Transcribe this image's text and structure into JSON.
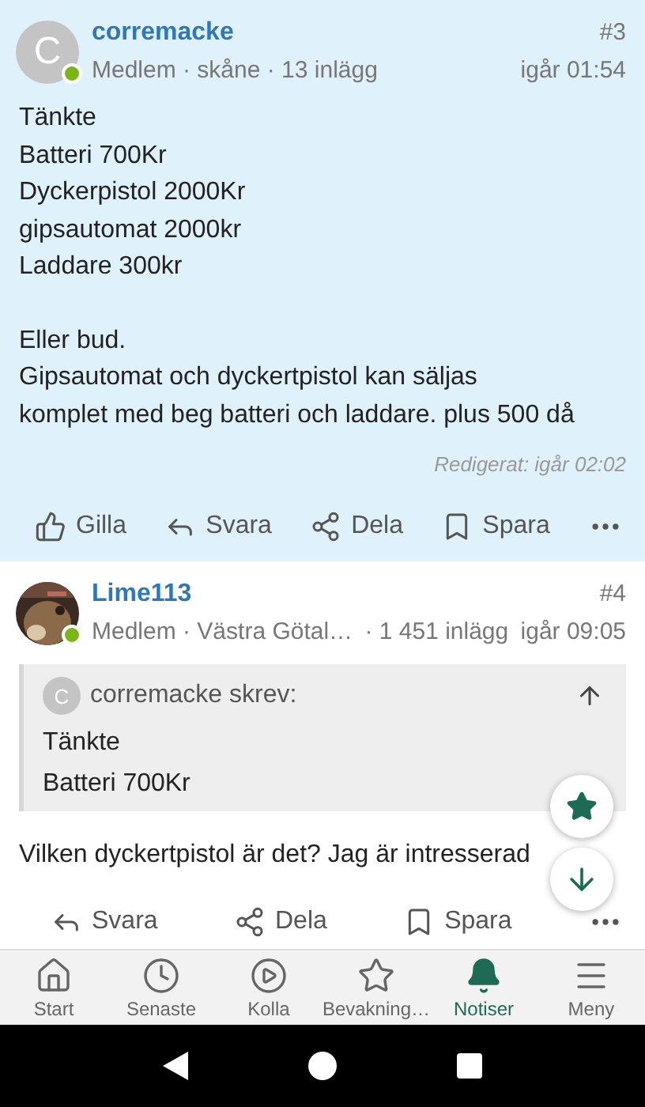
{
  "posts": [
    {
      "author": "corremacke",
      "avatar": {
        "kind": "letter",
        "letter": "C"
      },
      "online": true,
      "highlighted": true,
      "meta": [
        "Medlem · skåne · 13 inlägg"
      ],
      "number": "#3",
      "time": "igår 01:54",
      "paragraphs": [
        [
          "Tänkte",
          "Batteri 700Kr",
          "Dyckerpistol 2000Kr",
          "gipsautomat 2000kr",
          "Laddare 300kr"
        ],
        [
          "Eller bud.",
          "Gipsautomat och dyckertpistol kan säljas",
          "komplet med beg batteri och laddare. plus 500 då"
        ]
      ],
      "edited": "Redigerat: igår 02:02",
      "actions": [
        {
          "kind": "like",
          "label": "Gilla"
        },
        {
          "kind": "reply",
          "label": "Svara"
        },
        {
          "kind": "share",
          "label": "Dela"
        },
        {
          "kind": "save",
          "label": "Spara"
        },
        {
          "kind": "more"
        }
      ]
    },
    {
      "author": "Lime113",
      "avatar": {
        "kind": "picture"
      },
      "online": true,
      "highlighted": false,
      "meta": [
        "Medlem · Västra Götal…",
        "· 1 451 inlägg"
      ],
      "number": "#4",
      "time": "igår 09:05",
      "quote": {
        "letter": "C",
        "header": "corremacke skrev:",
        "lines": [
          "Tänkte",
          "Batteri 700Kr"
        ]
      },
      "paragraphs": [
        [
          "Vilken dyckertpistol är det? Jag är intresserad"
        ]
      ],
      "actions": [
        {
          "kind": "reply",
          "label": "Svara"
        },
        {
          "kind": "share",
          "label": "Dela"
        },
        {
          "kind": "save",
          "label": "Spara"
        },
        {
          "kind": "more"
        }
      ]
    }
  ],
  "floating_buttons": [
    {
      "kind": "star"
    },
    {
      "kind": "down"
    }
  ],
  "tabs": [
    {
      "kind": "home",
      "label": "Start",
      "selected": false
    },
    {
      "kind": "clock",
      "label": "Senaste",
      "selected": false
    },
    {
      "kind": "play",
      "label": "Kolla",
      "selected": false
    },
    {
      "kind": "star",
      "label": "Bevakning…",
      "selected": false
    },
    {
      "kind": "bell",
      "label": "Notiser",
      "selected": true
    },
    {
      "kind": "menu",
      "label": "Meny",
      "selected": false
    }
  ],
  "system_nav": [
    {
      "kind": "back"
    },
    {
      "kind": "home"
    },
    {
      "kind": "recents"
    }
  ]
}
